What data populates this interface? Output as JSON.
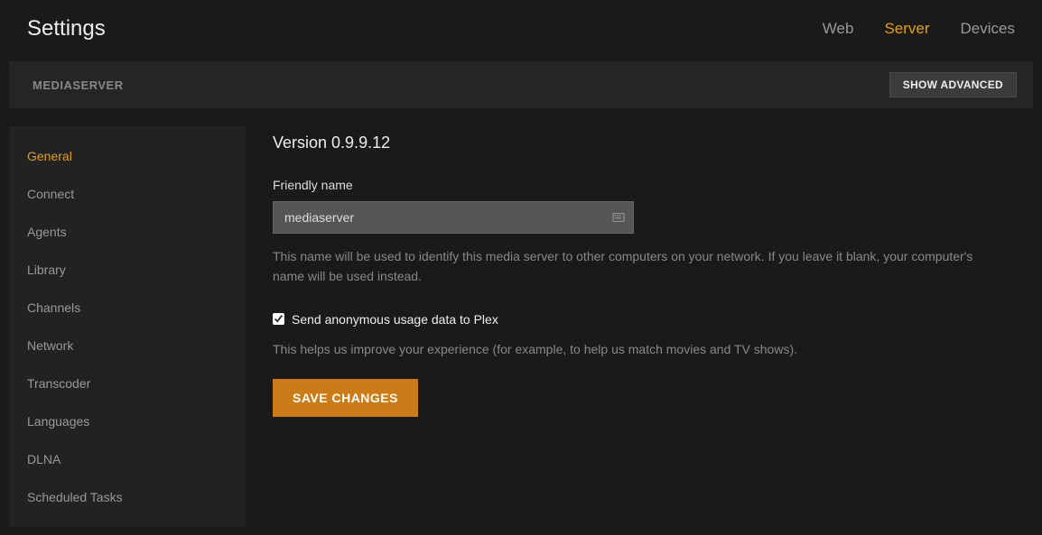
{
  "header": {
    "title": "Settings",
    "nav": [
      {
        "label": "Web",
        "active": false
      },
      {
        "label": "Server",
        "active": true
      },
      {
        "label": "Devices",
        "active": false
      }
    ]
  },
  "subheader": {
    "title": "MEDIASERVER",
    "show_advanced_label": "SHOW ADVANCED"
  },
  "sidebar": {
    "items": [
      {
        "label": "General",
        "active": true
      },
      {
        "label": "Connect",
        "active": false
      },
      {
        "label": "Agents",
        "active": false
      },
      {
        "label": "Library",
        "active": false
      },
      {
        "label": "Channels",
        "active": false
      },
      {
        "label": "Network",
        "active": false
      },
      {
        "label": "Transcoder",
        "active": false
      },
      {
        "label": "Languages",
        "active": false
      },
      {
        "label": "DLNA",
        "active": false
      },
      {
        "label": "Scheduled Tasks",
        "active": false
      }
    ]
  },
  "main": {
    "version_label": "Version 0.9.9.12",
    "friendly_name": {
      "label": "Friendly name",
      "value": "mediaserver",
      "help": "This name will be used to identify this media server to other computers on your network. If you leave it blank, your computer's name will be used instead."
    },
    "anon_data": {
      "checked": true,
      "label": "Send anonymous usage data to Plex",
      "help": "This helps us improve your experience (for example, to help us match movies and TV shows)."
    },
    "save_label": "SAVE CHANGES"
  }
}
